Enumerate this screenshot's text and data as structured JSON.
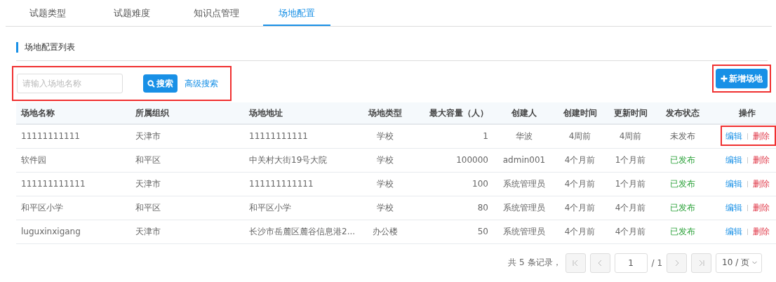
{
  "tabs": [
    {
      "label": "试题类型",
      "selected": false
    },
    {
      "label": "试题难度",
      "selected": false
    },
    {
      "label": "知识点管理",
      "selected": false
    },
    {
      "label": "场地配置",
      "selected": true
    }
  ],
  "section_title": "场地配置列表",
  "toolbar": {
    "highlighted": true,
    "search": {
      "placeholder": "请输入场地名称"
    },
    "search_button": "搜索",
    "advanced_search": "高级搜索"
  },
  "add_button": {
    "label": "新增场地",
    "highlighted": true
  },
  "table": {
    "columns": [
      "场地名称",
      "所属组织",
      "场地地址",
      "场地类型",
      "最大容量（人）",
      "创建人",
      "创建时间",
      "更新时间",
      "发布状态",
      "操作"
    ],
    "rows": [
      {
        "cells": [
          "11111111111",
          "天津市",
          "11111111111",
          "学校",
          "1",
          "华波",
          "4周前",
          "4周前"
        ],
        "status": "未发布",
        "published": false,
        "edit": "编辑",
        "delete": "删除",
        "highlighted": true
      },
      {
        "cells": [
          "软件园",
          "和平区",
          "中关村大街19号大院",
          "学校",
          "100000",
          "admin001",
          "4个月前",
          "1个月前"
        ],
        "status": "已发布",
        "published": true,
        "edit": "编辑",
        "delete": "删除",
        "highlighted": false
      },
      {
        "cells": [
          "111111111111",
          "天津市",
          "111111111111",
          "学校",
          "100",
          "系统管理员",
          "4个月前",
          "1个月前"
        ],
        "status": "已发布",
        "published": true,
        "edit": "编辑",
        "delete": "删除",
        "highlighted": false
      },
      {
        "cells": [
          "和平区小学",
          "和平区",
          "和平区小学",
          "学校",
          "80",
          "系统管理员",
          "4个月前",
          "4个月前"
        ],
        "status": "已发布",
        "published": true,
        "edit": "编辑",
        "delete": "删除",
        "highlighted": false
      },
      {
        "cells": [
          "luguxinxigang",
          "天津市",
          "长沙市岳麓区麓谷信息港2...",
          "办公楼",
          "50",
          "系统管理员",
          "4个月前",
          "4个月前"
        ],
        "status": "已发布",
        "published": true,
        "edit": "编辑",
        "delete": "删除",
        "highlighted": false
      }
    ]
  },
  "pagination": {
    "total": "共 5 条记录，",
    "page": "1",
    "pages": "/ 1",
    "page_size": "10 / 页"
  }
}
